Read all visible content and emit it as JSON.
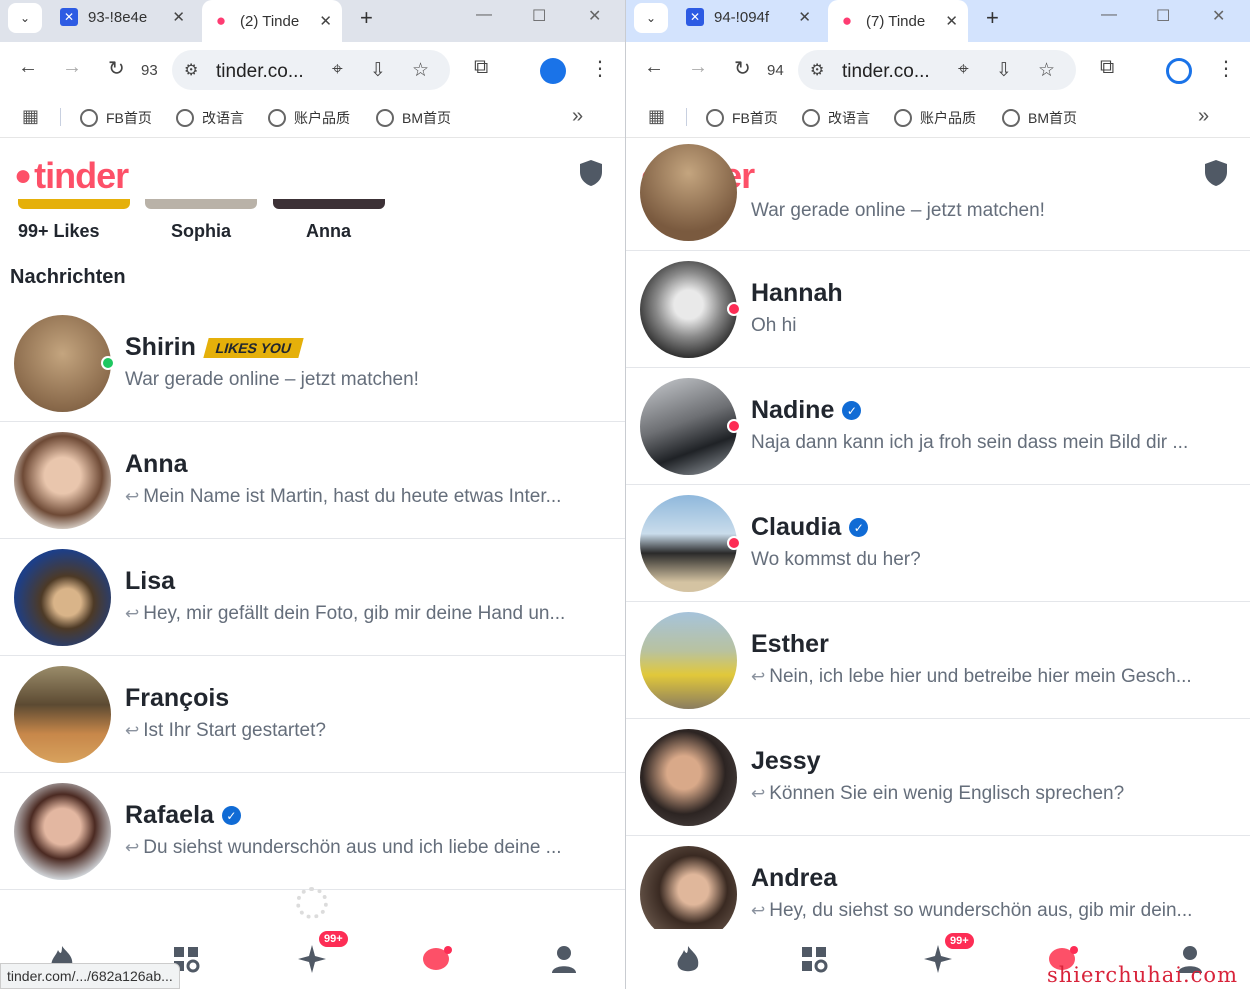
{
  "left": {
    "tabs": [
      {
        "title": "93-!8e4e",
        "favicon": "blue-x-icon"
      },
      {
        "title": "(2) Tinde",
        "favicon": "tinder-flame-icon"
      }
    ],
    "reload_number": "93",
    "url": "tinder.co...",
    "bookmarks": [
      "FB首页",
      "改语言",
      "账户品质",
      "BM首页"
    ],
    "stories": [
      "99+ Likes",
      "Sophia",
      "Anna"
    ],
    "section_title": "Nachrichten",
    "messages": [
      {
        "name": "Shirin",
        "badge": "LIKES YOU",
        "preview": "War gerade online – jetzt matchen!",
        "reply": false,
        "dot": "#1ec760"
      },
      {
        "name": "Anna",
        "preview": "Mein Name ist Martin, hast du heute etwas Inter...",
        "reply": true
      },
      {
        "name": "Lisa",
        "preview": "Hey, mir gefällt dein Foto, gib mir deine Hand un...",
        "reply": true
      },
      {
        "name": "François",
        "preview": "Ist Ihr Start gestartet?",
        "reply": true
      },
      {
        "name": "Rafaela",
        "verified": true,
        "preview": "Du siehst wunderschön aus und ich liebe deine ...",
        "reply": true
      }
    ],
    "nav_badge": "99+",
    "status_url": "tinder.com/.../682a126ab..."
  },
  "right": {
    "tabs": [
      {
        "title": "94-!094f",
        "favicon": "blue-x-icon"
      },
      {
        "title": "(7) Tinde",
        "favicon": "tinder-flame-icon"
      }
    ],
    "reload_number": "94",
    "url": "tinder.co...",
    "bookmarks": [
      "FB首页",
      "改语言",
      "账户品质",
      "BM首页"
    ],
    "top_partial_preview": "War gerade online – jetzt matchen!",
    "messages": [
      {
        "name": "Hannah",
        "preview": "Oh hi",
        "reply": false,
        "dot": "#fd2d55"
      },
      {
        "name": "Nadine",
        "verified": true,
        "preview": "Naja dann kann ich ja froh sein dass mein Bild dir ...",
        "reply": false,
        "dot": "#fd2d55"
      },
      {
        "name": "Claudia",
        "verified": true,
        "preview": "Wo kommst du her?",
        "reply": false,
        "dot": "#fd2d55"
      },
      {
        "name": "Esther",
        "preview": "Nein, ich lebe hier und betreibe hier mein Gesch...",
        "reply": true
      },
      {
        "name": "Jessy",
        "preview": "Können Sie ein wenig Englisch sprechen?",
        "reply": true
      },
      {
        "name": "Andrea",
        "preview": "Hey, du siehst so wunderschön aus, gib mir dein...",
        "reply": true
      }
    ],
    "nav_badge": "99+"
  },
  "brand": {
    "logo_text": "tinder",
    "color": "#fd5068"
  },
  "watermark": "shierchuhai.com"
}
